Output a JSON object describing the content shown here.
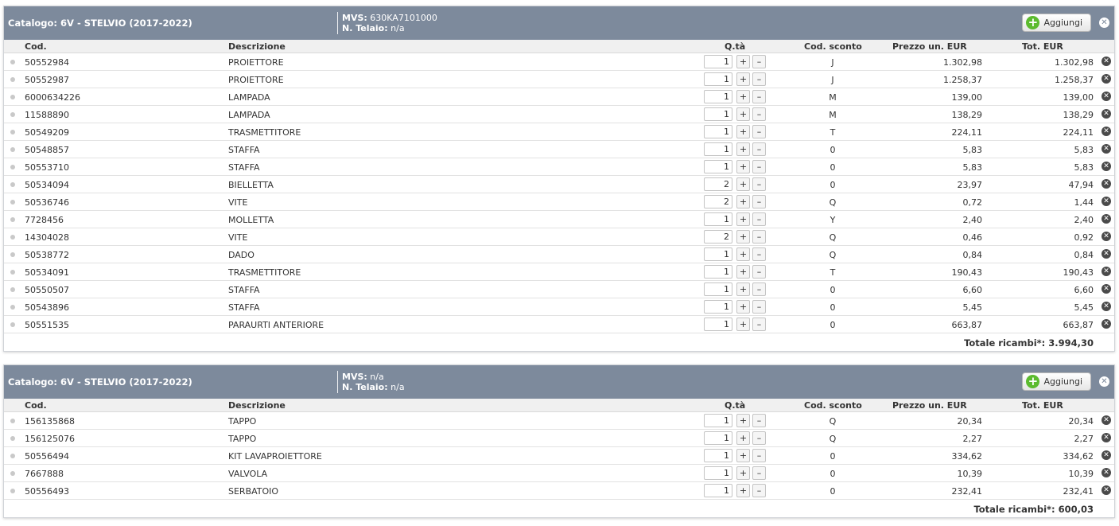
{
  "columns": {
    "code": "Cod.",
    "description": "Descrizione",
    "qty": "Q.tà",
    "discount_code": "Cod. sconto",
    "unit_price": "Prezzo un. EUR",
    "total": "Tot. EUR"
  },
  "add_label": "Aggiungi",
  "icons": {
    "add": "plus-circle-icon",
    "close": "close-circle-icon",
    "remove": "remove-circle-icon",
    "bullet": "bullet-dot-icon"
  },
  "colors": {
    "header_bg": "#7d8a9c",
    "add_green": "#5cbb2f"
  },
  "panels": [
    {
      "catalog_label": "Catalogo: 6V - STELVIO (2017-2022)",
      "mvs_label": "MVS:",
      "mvs_value": "630KA7101000",
      "telaio_label": "N. Telaio:",
      "telaio_value": "n/a",
      "rows": [
        {
          "code": "50552984",
          "desc": "PROIETTORE",
          "qty": "1",
          "sconto": "J",
          "price": "1.302,98",
          "total": "1.302,98"
        },
        {
          "code": "50552987",
          "desc": "PROIETTORE",
          "qty": "1",
          "sconto": "J",
          "price": "1.258,37",
          "total": "1.258,37"
        },
        {
          "code": "6000634226",
          "desc": "LAMPADA",
          "qty": "1",
          "sconto": "M",
          "price": "139,00",
          "total": "139,00"
        },
        {
          "code": "11588890",
          "desc": "LAMPADA",
          "qty": "1",
          "sconto": "M",
          "price": "138,29",
          "total": "138,29"
        },
        {
          "code": "50549209",
          "desc": "TRASMETTITORE",
          "qty": "1",
          "sconto": "T",
          "price": "224,11",
          "total": "224,11"
        },
        {
          "code": "50548857",
          "desc": "STAFFA",
          "qty": "1",
          "sconto": "0",
          "price": "5,83",
          "total": "5,83"
        },
        {
          "code": "50553710",
          "desc": "STAFFA",
          "qty": "1",
          "sconto": "0",
          "price": "5,83",
          "total": "5,83"
        },
        {
          "code": "50534094",
          "desc": "BIELLETTA",
          "qty": "2",
          "sconto": "0",
          "price": "23,97",
          "total": "47,94"
        },
        {
          "code": "50536746",
          "desc": "VITE",
          "qty": "2",
          "sconto": "Q",
          "price": "0,72",
          "total": "1,44"
        },
        {
          "code": "7728456",
          "desc": "MOLLETTA",
          "qty": "1",
          "sconto": "Y",
          "price": "2,40",
          "total": "2,40"
        },
        {
          "code": "14304028",
          "desc": "VITE",
          "qty": "2",
          "sconto": "Q",
          "price": "0,46",
          "total": "0,92"
        },
        {
          "code": "50538772",
          "desc": "DADO",
          "qty": "1",
          "sconto": "Q",
          "price": "0,84",
          "total": "0,84"
        },
        {
          "code": "50534091",
          "desc": "TRASMETTITORE",
          "qty": "1",
          "sconto": "T",
          "price": "190,43",
          "total": "190,43"
        },
        {
          "code": "50550507",
          "desc": "STAFFA",
          "qty": "1",
          "sconto": "0",
          "price": "6,60",
          "total": "6,60"
        },
        {
          "code": "50543896",
          "desc": "STAFFA",
          "qty": "1",
          "sconto": "0",
          "price": "5,45",
          "total": "5,45"
        },
        {
          "code": "50551535",
          "desc": "PARAURTI ANTERIORE",
          "qty": "1",
          "sconto": "0",
          "price": "663,87",
          "total": "663,87"
        }
      ],
      "total_text": "Totale ricambi*: 3.994,30"
    },
    {
      "catalog_label": "Catalogo: 6V - STELVIO (2017-2022)",
      "mvs_label": "MVS:",
      "mvs_value": "n/a",
      "telaio_label": "N. Telaio:",
      "telaio_value": "n/a",
      "rows": [
        {
          "code": "156135868",
          "desc": "TAPPO",
          "qty": "1",
          "sconto": "Q",
          "price": "20,34",
          "total": "20,34"
        },
        {
          "code": "156125076",
          "desc": "TAPPO",
          "qty": "1",
          "sconto": "Q",
          "price": "2,27",
          "total": "2,27"
        },
        {
          "code": "50556494",
          "desc": "KIT LAVAPROIETTORE",
          "qty": "1",
          "sconto": "0",
          "price": "334,62",
          "total": "334,62"
        },
        {
          "code": "7667888",
          "desc": "VALVOLA",
          "qty": "1",
          "sconto": "0",
          "price": "10,39",
          "total": "10,39"
        },
        {
          "code": "50556493",
          "desc": "SERBATOIO",
          "qty": "1",
          "sconto": "0",
          "price": "232,41",
          "total": "232,41"
        }
      ],
      "total_text": "Totale ricambi*: 600,03"
    }
  ]
}
